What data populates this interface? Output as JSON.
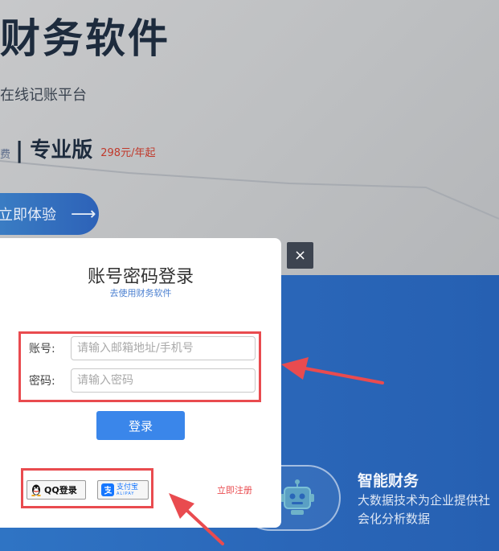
{
  "hero": {
    "title": "财务软件",
    "subtitle": "在线记账平台",
    "prev_edition_fragment": "费",
    "separator": "|",
    "edition_name": "专业版",
    "edition_price": "298元/年起",
    "try_button_label": "立即体验",
    "try_button_arrow": "⟶"
  },
  "feature": {
    "title": "智能财务",
    "description": "大数据技术为企业提供社会化分析数据",
    "icon": "robot-icon"
  },
  "modal": {
    "close_icon": "×",
    "title": "账号密码登录",
    "subtitle": "去使用财务软件",
    "account_label": "账号:",
    "account_placeholder": "请输入邮箱地址/手机号",
    "password_label": "密码:",
    "password_placeholder": "请输入密码",
    "login_label": "登录",
    "qq_login_label": "QQ登录",
    "alipay_label": "支付宝",
    "alipay_sub": "ALIPAY",
    "register_label": "立即注册"
  },
  "colors": {
    "highlight": "#e94b4f",
    "primary": "#3a86ea",
    "band": "#2a66b8"
  }
}
